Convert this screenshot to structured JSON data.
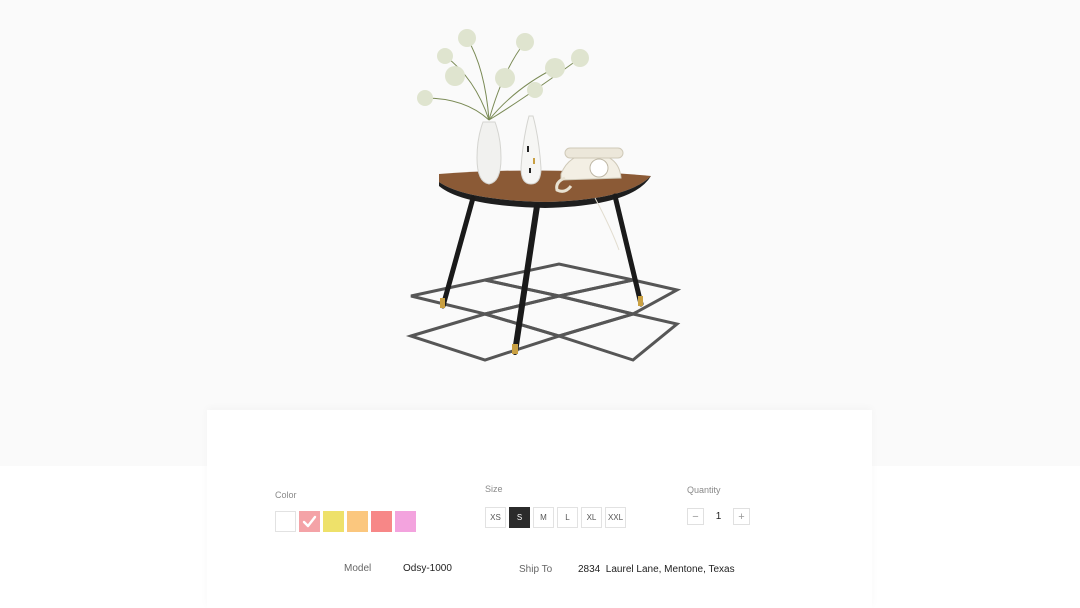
{
  "product": {
    "image_alt": "Mid-century half-moon side table with vases and rotary telephone on a diamond-pattern rug"
  },
  "options": {
    "color": {
      "label": "Color",
      "swatches": [
        {
          "name": "white",
          "hex": "#ffffff",
          "selected": false
        },
        {
          "name": "pink",
          "hex": "#f4a3a7",
          "selected": true
        },
        {
          "name": "yellow",
          "hex": "#eee16a",
          "selected": false
        },
        {
          "name": "orange",
          "hex": "#fbc77e",
          "selected": false
        },
        {
          "name": "coral",
          "hex": "#f78787",
          "selected": false
        },
        {
          "name": "violet",
          "hex": "#f3a3de",
          "selected": false
        }
      ]
    },
    "size": {
      "label": "Size",
      "items": [
        "XS",
        "S",
        "M",
        "L",
        "XL",
        "XXL"
      ],
      "selected": "S"
    },
    "quantity": {
      "label": "Quantity",
      "minus": "−",
      "value": "1",
      "plus": "+"
    }
  },
  "details": {
    "model_label": "Model",
    "model_value": "Odsy-1000",
    "ship_label": "Ship To",
    "ship_value": "2834  Laurel Lane, Mentone, Texas"
  }
}
